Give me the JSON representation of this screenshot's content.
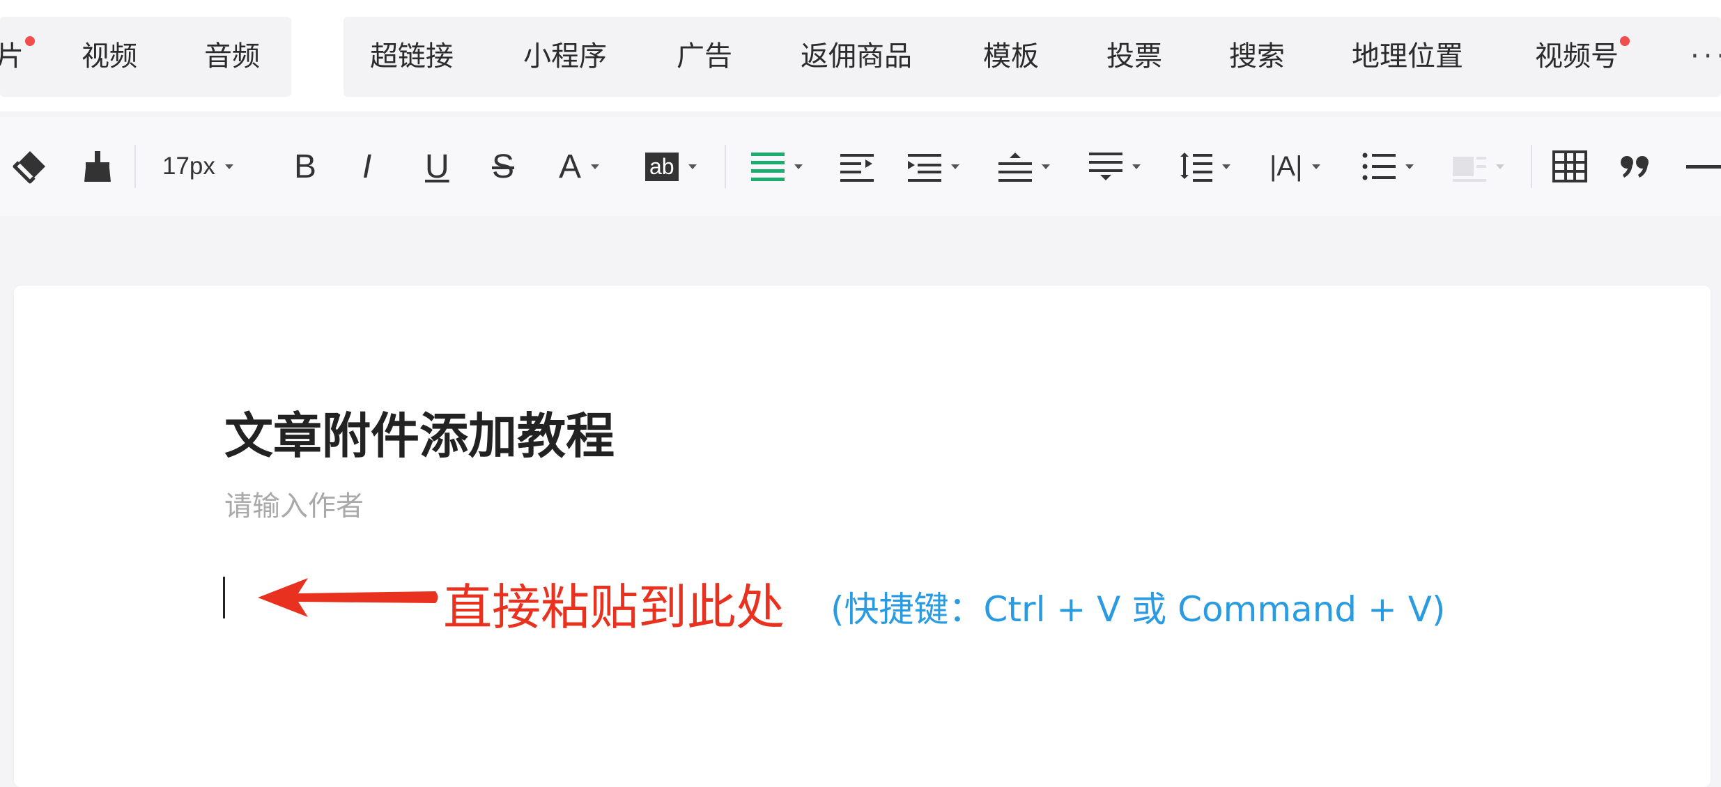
{
  "insert_bar": {
    "group_a": [
      {
        "label": "片",
        "dot": true
      },
      {
        "label": "视频",
        "dot": false
      },
      {
        "label": "音频",
        "dot": false
      }
    ],
    "group_b": [
      {
        "label": "超链接",
        "dot": false
      },
      {
        "label": "小程序",
        "dot": false
      },
      {
        "label": "广告",
        "dot": false
      },
      {
        "label": "返佣商品",
        "dot": false
      },
      {
        "label": "模板",
        "dot": false
      },
      {
        "label": "投票",
        "dot": false
      },
      {
        "label": "搜索",
        "dot": false
      },
      {
        "label": "地理位置",
        "dot": false
      },
      {
        "label": "视频号",
        "dot": true
      }
    ],
    "more_label": "···"
  },
  "toolbar": {
    "font_size": "17px",
    "bold": "B",
    "italic": "I",
    "underline": "U",
    "strike": "S",
    "font_color": "A",
    "highlight": "ab",
    "letter_spacing": "|A|",
    "accent_color": "#1aad6e",
    "icons": [
      "format-painter-icon",
      "clear-format-icon",
      "align-icon",
      "indent-icon",
      "first-line-indent-icon",
      "paragraph-spacing-before-icon",
      "paragraph-spacing-after-icon",
      "line-height-icon",
      "list-icon",
      "float-icon",
      "table-icon",
      "quote-icon",
      "divider-icon"
    ]
  },
  "editor": {
    "title": "文章附件添加教程",
    "author_placeholder": "请输入作者",
    "annotation_main": "直接粘贴到此处",
    "annotation_hint": "(快捷键：Ctrl + V  或 Command + V)",
    "annotation_color": "#e8321f",
    "hint_color": "#2a9be0"
  }
}
